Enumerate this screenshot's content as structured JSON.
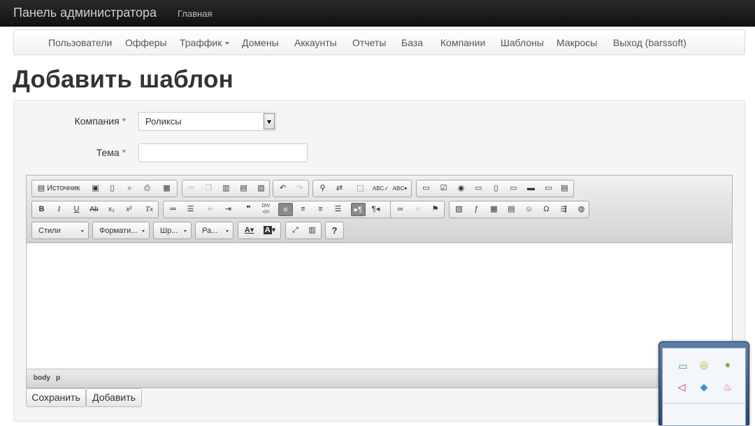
{
  "topbar": {
    "brand": "Панель администратора",
    "home": "Главная"
  },
  "subnav": {
    "items": [
      "Пользователи",
      "Офферы",
      "Траффик",
      "Домены",
      "Аккаунты",
      "Отчеты",
      "База",
      "Компании",
      "Шаблоны",
      "Макросы",
      "Выход (barssoft)"
    ]
  },
  "page": {
    "title": "Добавить шаблон"
  },
  "form": {
    "company_label": "Компания",
    "company_value": "Роликсы",
    "topic_label": "Тема",
    "topic_value": "",
    "required_mark": "*"
  },
  "editor": {
    "source_label": "Источник",
    "styles_label": "Стили",
    "format_label": "Формати...",
    "font_label": "Шр...",
    "size_label": "Ра...",
    "path": [
      "body",
      "p"
    ]
  },
  "buttons": {
    "save": "Сохранить",
    "add": "Добавить"
  },
  "colors": {
    "navbar": "#1b1b1b",
    "required": "#b94a48",
    "panel": "#f5f5f5"
  }
}
